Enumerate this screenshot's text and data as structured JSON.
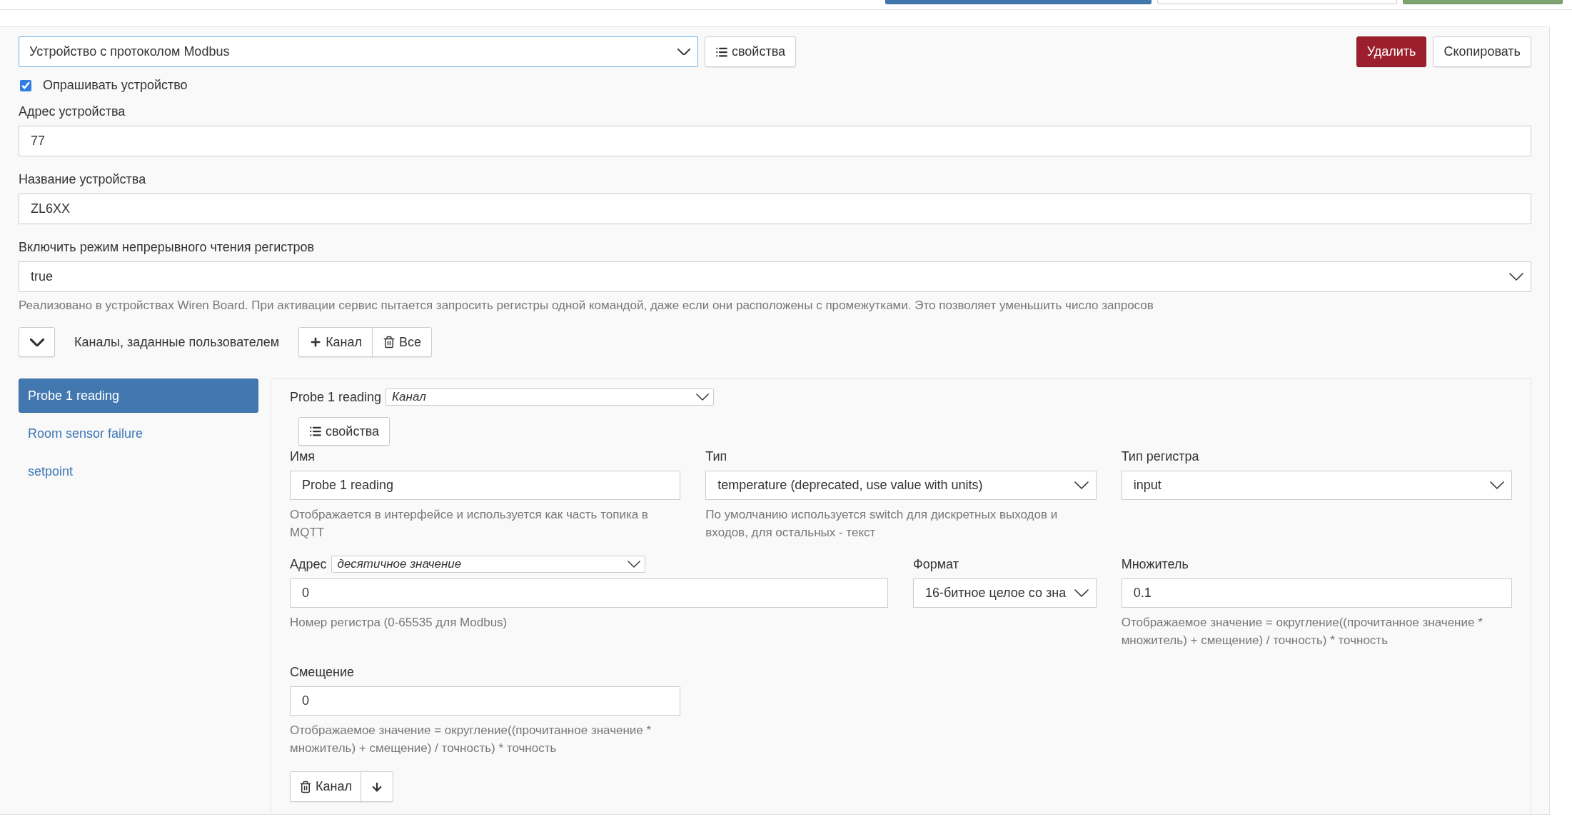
{
  "device": {
    "protocol_select": "Устройство с протоколом Modbus",
    "properties_button": "свойства",
    "actions": [
      {
        "label": "Удалить",
        "kind": "danger"
      },
      {
        "label": "Скопировать",
        "kind": "default"
      }
    ],
    "poll": {
      "label": "Опрашивать устройство",
      "checked": true
    },
    "fields": [
      {
        "label": "Адрес устройства",
        "kind": "input",
        "value": "77"
      },
      {
        "label": "Название устройства",
        "kind": "input",
        "value": "ZL6XX"
      },
      {
        "label": "Включить режим непрерывного чтения регистров",
        "kind": "select",
        "value": "true",
        "help": "Реализовано в устройствах Wiren Board. При активации сервис пытается запросить регистры одной командой, даже если они расположены с промежутками. Это позволяет уменьшить число запросов"
      }
    ]
  },
  "channels": {
    "expanded": true,
    "title": "Каналы, заданные пользователем",
    "buttons": [
      {
        "label": "Канал",
        "kind": "add"
      },
      {
        "label": "Все",
        "kind": "delete"
      }
    ],
    "list": [
      {
        "label": "Probe 1 reading",
        "selected": true
      },
      {
        "label": "Room sensor failure",
        "selected": false
      },
      {
        "label": "setpoint",
        "selected": false
      }
    ],
    "editor": {
      "name": "Probe 1 reading",
      "type_select": "Канал",
      "properties_button": "свойства",
      "rows": [
        [
          {
            "label": "Имя",
            "kind": "input",
            "value": "Probe 1 reading",
            "help": "Отображается в интерфейсе и используется как часть топика в MQTT"
          },
          {
            "label": "Тип",
            "kind": "select",
            "value": "temperature (deprecated, use value with units)",
            "help": "По умолчанию используется switch для дискретных выходов и входов, для остальных - текст"
          },
          {
            "label": "Тип регистра",
            "kind": "select",
            "value": "input"
          }
        ],
        [
          {
            "label": "Адрес",
            "label_select": "десятичное значение",
            "kind": "input",
            "value": "0",
            "help": "Номер регистра (0-65535 для Modbus)"
          },
          {
            "label": "Формат",
            "kind": "select",
            "value": "16-битное целое со зна"
          },
          {
            "label": "Множитель",
            "kind": "input",
            "value": "0.1",
            "help": "Отображаемое значение = округление((прочитанное значение * множитель) + смещение) / точность) * точность"
          }
        ],
        [
          {
            "label": "Смещение",
            "kind": "input",
            "value": "0",
            "help": "Отображаемое значение = округление((прочитанное значение * множитель) + смещение) / точность) * точность"
          }
        ]
      ],
      "buttons": [
        {
          "label": "Канал",
          "kind": "delete"
        },
        {
          "kind": "down"
        }
      ]
    }
  }
}
